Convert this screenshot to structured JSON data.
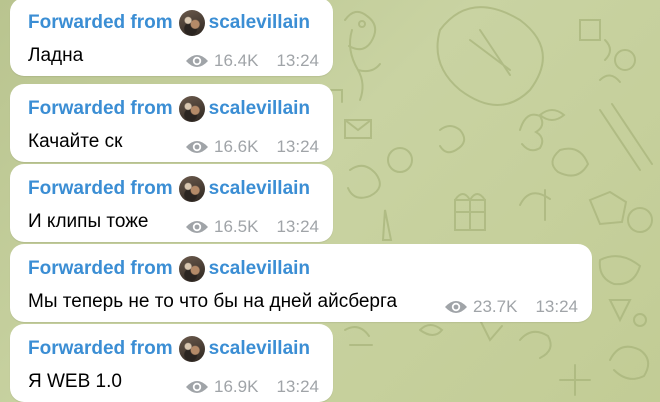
{
  "colors": {
    "forward_link": "#3b8ed4",
    "meta_text": "#a0a4a8",
    "bubble": "#ffffff",
    "wallpaper": "#c2cc95"
  },
  "messages": [
    {
      "forwarded_label": "Forwarded from",
      "channel": "scalevillain",
      "text": "Ладна",
      "views": "16.4K",
      "time": "13:24"
    },
    {
      "forwarded_label": "Forwarded from",
      "channel": "scalevillain",
      "text": "Качайте ск",
      "views": "16.6K",
      "time": "13:24"
    },
    {
      "forwarded_label": "Forwarded from",
      "channel": "scalevillain",
      "text": "И клипы тоже",
      "views": "16.5K",
      "time": "13:24"
    },
    {
      "forwarded_label": "Forwarded from",
      "channel": "scalevillain",
      "text": "Мы теперь не то что бы на дней айсберга",
      "views": "23.7K",
      "time": "13:24"
    },
    {
      "forwarded_label": "Forwarded from",
      "channel": "scalevillain",
      "text": "Я WEB 1.0",
      "views": "16.9K",
      "time": "13:24"
    }
  ]
}
